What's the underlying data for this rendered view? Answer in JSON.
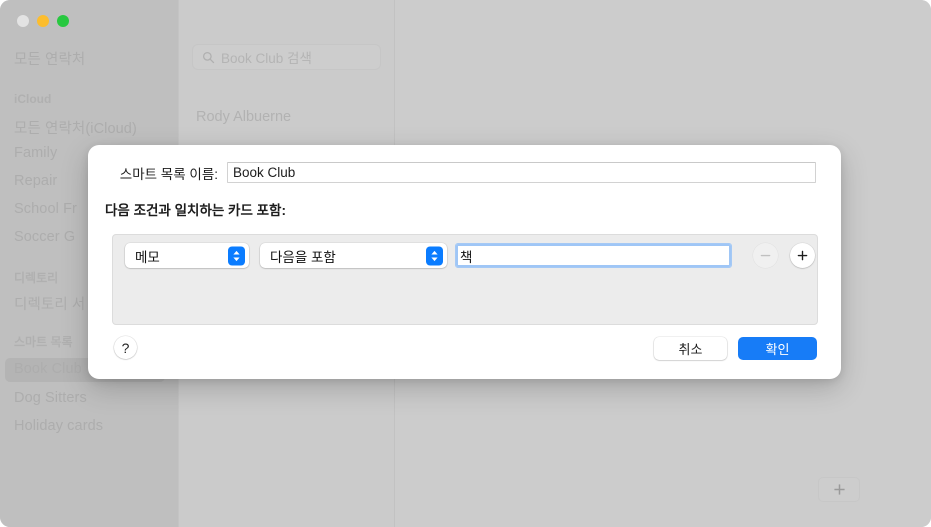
{
  "window": {
    "traffic_lights": [
      "close",
      "minimize",
      "maximize"
    ]
  },
  "sidebar": {
    "top_item": {
      "label": "모든 연락처"
    },
    "groups": [
      {
        "header": "iCloud",
        "items": [
          {
            "label": "모든 연락처(iCloud)"
          },
          {
            "label": "Family"
          },
          {
            "label": "Repair"
          },
          {
            "label": "School Fr"
          },
          {
            "label": "Soccer G"
          }
        ]
      },
      {
        "header": "디렉토리",
        "items": [
          {
            "label": "디렉토리 서"
          }
        ]
      },
      {
        "header": "스마트 목록",
        "items": [
          {
            "label": "Book Club",
            "selected": true
          },
          {
            "label": "Dog Sitters"
          },
          {
            "label": "Holiday cards"
          }
        ]
      }
    ]
  },
  "middle_column": {
    "search": {
      "icon": "search-icon",
      "placeholder": "Book Club 검색",
      "value": ""
    },
    "contacts": [
      {
        "name": "Rody Albuerne"
      }
    ]
  },
  "detail_pane": {
    "add_card_label": "+"
  },
  "dialog": {
    "name_label": "스마트 목록 이름:",
    "name_value": "Book Club",
    "name_placeholder": "",
    "match_label": "다음 조건과 일치하는 카드 포함:",
    "conditions": [
      {
        "field": "메모",
        "operator": "다음을 포함",
        "value": "책",
        "value_placeholder": "",
        "remove_label": "−",
        "add_label": "+",
        "remove_enabled": false
      }
    ],
    "help_label": "?",
    "cancel_label": "취소",
    "confirm_label": "확인"
  },
  "colors": {
    "accent": "#177cf7",
    "popup_chevron": "#0a7cff",
    "focus_ring": "#9fc6f6",
    "window_bg": "#cccccc",
    "sidebar_bg": "#bfbfbf"
  }
}
